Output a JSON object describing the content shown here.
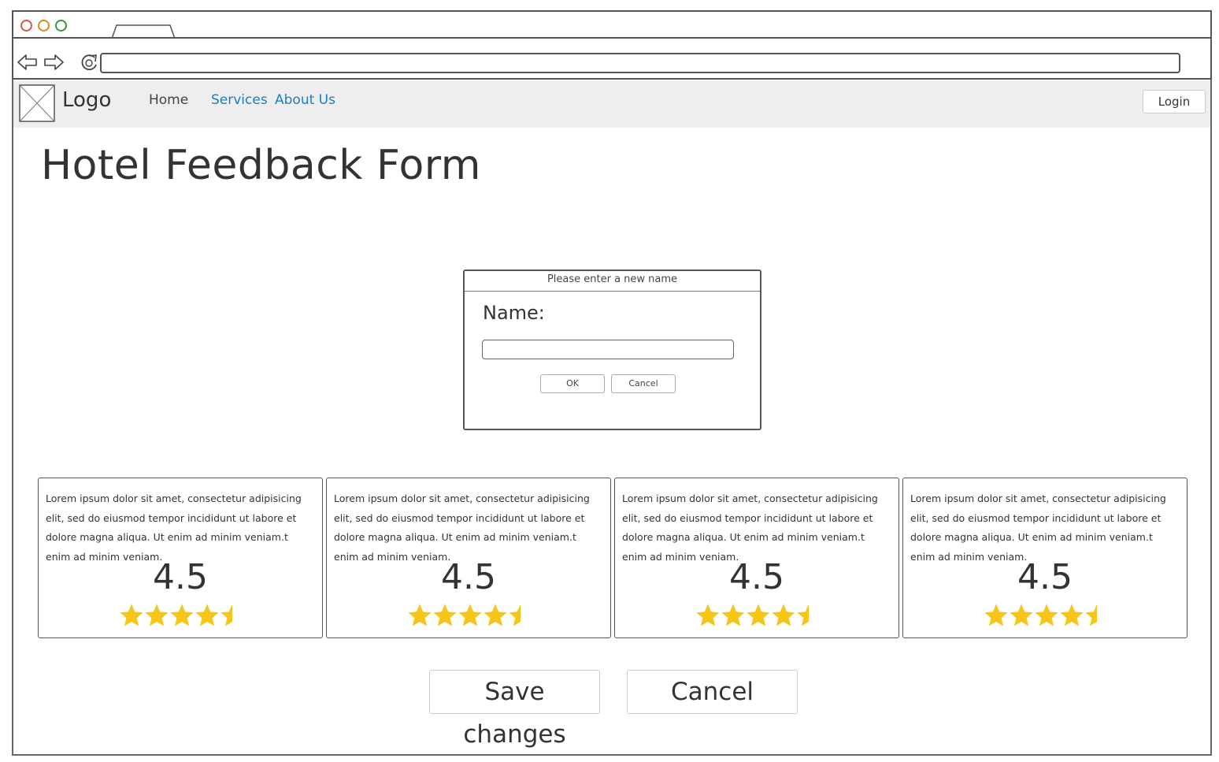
{
  "browser": {
    "url": ""
  },
  "site": {
    "logo_text": "Logo",
    "nav": {
      "home": "Home",
      "services": "Services",
      "about": "About Us"
    },
    "login": "Login"
  },
  "page": {
    "title": "Hotel Feedback Form"
  },
  "dialog": {
    "title": "Please enter a new name",
    "label": "Name:",
    "input_value": "",
    "ok": "OK",
    "cancel": "Cancel"
  },
  "cards": [
    {
      "text": "Lorem ipsum dolor sit amet, consectetur adipisicing elit, sed do eiusmod tempor incididunt ut labore et dolore magna aliqua. Ut enim ad minim veniam.t enim ad minim veniam.",
      "rating": "4.5",
      "stars": 4.5
    },
    {
      "text": "Lorem ipsum dolor sit amet, consectetur adipisicing elit, sed do eiusmod tempor incididunt ut labore et dolore magna aliqua. Ut enim ad minim veniam.t enim ad minim veniam.",
      "rating": "4.5",
      "stars": 4.5
    },
    {
      "text": "Lorem ipsum dolor sit amet, consectetur adipisicing elit, sed do eiusmod tempor incididunt ut labore et dolore magna aliqua. Ut enim ad minim veniam.t enim ad minim veniam.",
      "rating": "4.5",
      "stars": 4.5
    },
    {
      "text": "Lorem ipsum dolor sit amet, consectetur adipisicing elit, sed do eiusmod tempor incididunt ut labore et dolore magna aliqua. Ut enim ad minim veniam.t enim ad minim veniam.",
      "rating": "4.5",
      "stars": 4.5
    }
  ],
  "actions": {
    "save": "Save changes",
    "cancel": "Cancel"
  },
  "icons": {
    "back": "back-arrow-icon",
    "forward": "forward-arrow-icon",
    "reload": "reload-icon",
    "logo": "image-placeholder-icon",
    "star": "star-icon"
  },
  "colors": {
    "link": "#1a7fbf",
    "star": "#f5c518",
    "window_dot_red": "#d9534f",
    "window_dot_orange": "#e08a1e",
    "window_dot_green": "#2a9d3a"
  }
}
